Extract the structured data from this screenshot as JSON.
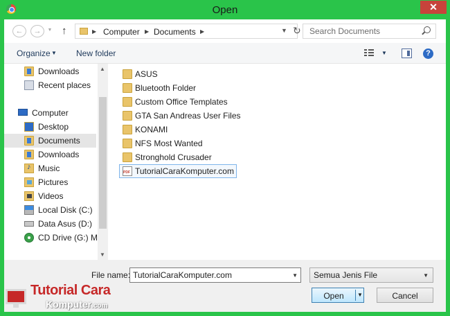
{
  "window": {
    "title": "Open",
    "close_glyph": "✕",
    "accent_color": "#2ac44a",
    "close_color": "#c7433b"
  },
  "nav": {
    "back_glyph": "←",
    "forward_glyph": "→",
    "up_glyph": "↑"
  },
  "address": {
    "crumbs": [
      "Computer",
      "Documents"
    ],
    "separator": "▶",
    "dropdown_glyph": "▼",
    "refresh_glyph": "↻"
  },
  "search": {
    "placeholder": "Search Documents"
  },
  "toolbar": {
    "organize_label": "Organize",
    "caret": "▼",
    "new_folder_label": "New folder",
    "help_glyph": "?"
  },
  "sidebar": {
    "items": [
      {
        "label": "Downloads",
        "icon": "downloads-folder-icon"
      },
      {
        "label": "Recent places",
        "icon": "recent-places-icon"
      },
      {
        "label": "Computer",
        "icon": "computer-icon"
      },
      {
        "label": "Desktop",
        "icon": "desktop-folder-icon"
      },
      {
        "label": "Documents",
        "icon": "documents-folder-icon",
        "selected": true
      },
      {
        "label": "Downloads",
        "icon": "downloads-folder-icon"
      },
      {
        "label": "Music",
        "icon": "music-folder-icon"
      },
      {
        "label": "Pictures",
        "icon": "pictures-folder-icon"
      },
      {
        "label": "Videos",
        "icon": "videos-folder-icon"
      },
      {
        "label": "Local Disk (C:)",
        "icon": "local-disk-icon"
      },
      {
        "label": "Data Asus (D:)",
        "icon": "drive-icon"
      },
      {
        "label": "CD Drive (G:) Mo",
        "icon": "cd-drive-icon"
      }
    ],
    "scroll_up_glyph": "▲",
    "scroll_down_glyph": "▼"
  },
  "files": {
    "items": [
      {
        "name": "ASUS",
        "icon": "folder-icon"
      },
      {
        "name": "Bluetooth Folder",
        "icon": "folder-icon"
      },
      {
        "name": "Custom Office Templates",
        "icon": "folder-icon"
      },
      {
        "name": "GTA San Andreas User Files",
        "icon": "folder-icon"
      },
      {
        "name": "KONAMI",
        "icon": "folder-icon"
      },
      {
        "name": "NFS Most Wanted",
        "icon": "folder-icon"
      },
      {
        "name": "Stronghold Crusader",
        "icon": "folder-icon"
      },
      {
        "name": "TutorialCaraKomputer.com",
        "icon": "pdf-file-icon",
        "selected": true
      }
    ]
  },
  "bottom": {
    "file_name_label": "File name:",
    "file_name_value": "TutorialCaraKomputer.com",
    "filter_value": "Semua Jenis File",
    "dropdown_glyph": "▼",
    "open_label": "Open",
    "cancel_label": "Cancel"
  },
  "watermark": {
    "line1": "Tutorial Cara",
    "line2": "Komputer",
    "line2_suffix": ".com",
    "brand_color": "#c62828"
  }
}
